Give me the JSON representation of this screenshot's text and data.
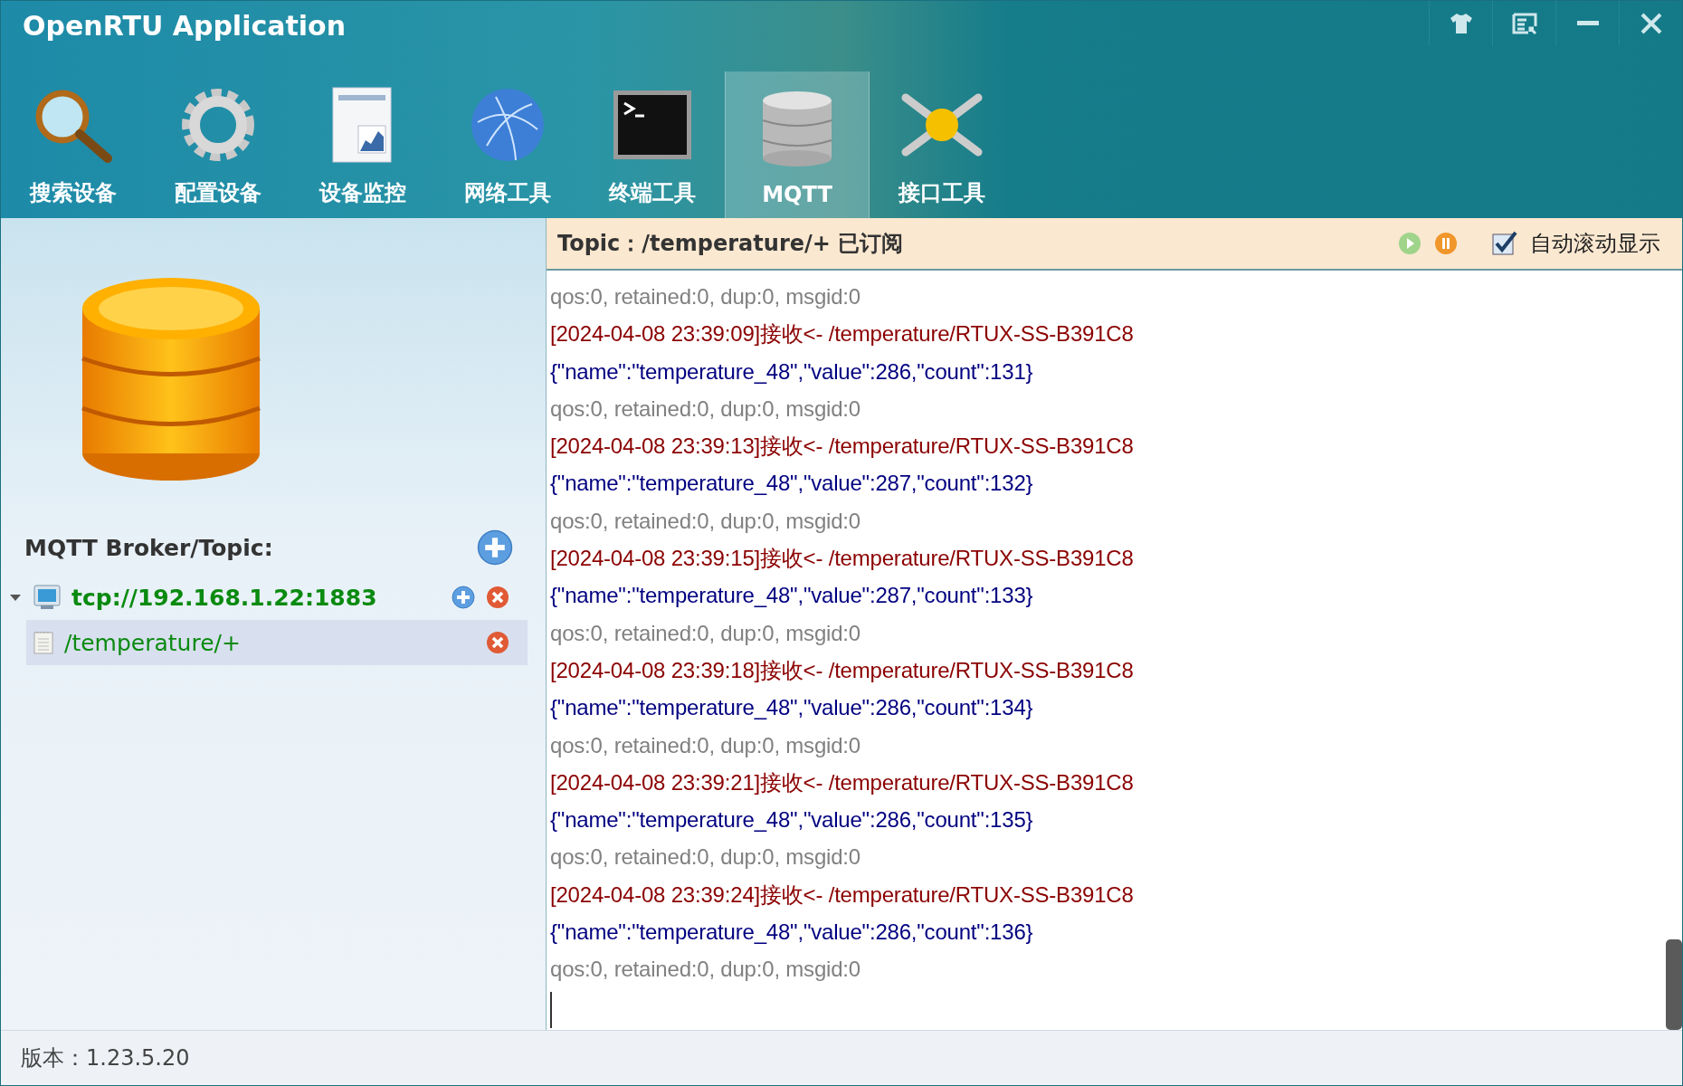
{
  "window": {
    "title": "OpenRTU Application"
  },
  "toolbar": [
    {
      "label": "搜索设备",
      "kind": "search",
      "selected": false
    },
    {
      "label": "配置设备",
      "kind": "gear",
      "selected": false
    },
    {
      "label": "设备监控",
      "kind": "chart",
      "selected": false
    },
    {
      "label": "网络工具",
      "kind": "globe",
      "selected": false
    },
    {
      "label": "终端工具",
      "kind": "terminal",
      "selected": false
    },
    {
      "label": "MQTT",
      "kind": "database",
      "selected": true
    },
    {
      "label": "接口工具",
      "kind": "connector",
      "selected": false
    }
  ],
  "sidebar": {
    "heading": "MQTT Broker/Topic:",
    "tree": [
      {
        "label": "tcp://192.168.1.22:1883",
        "kind": "broker",
        "expanded": true,
        "selected": false,
        "children": [
          {
            "label": "/temperature/+",
            "kind": "topic",
            "selected": true
          }
        ]
      }
    ]
  },
  "topic_bar": {
    "text": "Topic：/temperature/+ 已订阅",
    "auto_scroll": {
      "label": "自动滚动显示",
      "checked": true
    }
  },
  "log": [
    {
      "kind": "meta",
      "text": "qos:0, retained:0, dup:0, msgid:0"
    },
    {
      "kind": "recv",
      "text": "[2024-04-08 23:39:09]接收<- /temperature/RTUX-SS-B391C8"
    },
    {
      "kind": "payload",
      "text": "{\"name\":\"temperature_48\",\"value\":286,\"count\":131}"
    },
    {
      "kind": "meta",
      "text": "qos:0, retained:0, dup:0, msgid:0"
    },
    {
      "kind": "recv",
      "text": "[2024-04-08 23:39:13]接收<- /temperature/RTUX-SS-B391C8"
    },
    {
      "kind": "payload",
      "text": "{\"name\":\"temperature_48\",\"value\":287,\"count\":132}"
    },
    {
      "kind": "meta",
      "text": "qos:0, retained:0, dup:0, msgid:0"
    },
    {
      "kind": "recv",
      "text": "[2024-04-08 23:39:15]接收<- /temperature/RTUX-SS-B391C8"
    },
    {
      "kind": "payload",
      "text": "{\"name\":\"temperature_48\",\"value\":287,\"count\":133}"
    },
    {
      "kind": "meta",
      "text": "qos:0, retained:0, dup:0, msgid:0"
    },
    {
      "kind": "recv",
      "text": "[2024-04-08 23:39:18]接收<- /temperature/RTUX-SS-B391C8"
    },
    {
      "kind": "payload",
      "text": "{\"name\":\"temperature_48\",\"value\":286,\"count\":134}"
    },
    {
      "kind": "meta",
      "text": "qos:0, retained:0, dup:0, msgid:0"
    },
    {
      "kind": "recv",
      "text": "[2024-04-08 23:39:21]接收<- /temperature/RTUX-SS-B391C8"
    },
    {
      "kind": "payload",
      "text": "{\"name\":\"temperature_48\",\"value\":286,\"count\":135}"
    },
    {
      "kind": "meta",
      "text": "qos:0, retained:0, dup:0, msgid:0"
    },
    {
      "kind": "recv",
      "text": "[2024-04-08 23:39:24]接收<- /temperature/RTUX-SS-B391C8"
    },
    {
      "kind": "payload",
      "text": "{\"name\":\"temperature_48\",\"value\":286,\"count\":136}"
    },
    {
      "kind": "meta",
      "text": "qos:0, retained:0, dup:0, msgid:0"
    }
  ],
  "status_bar": {
    "version": "版本：1.23.5.20"
  }
}
